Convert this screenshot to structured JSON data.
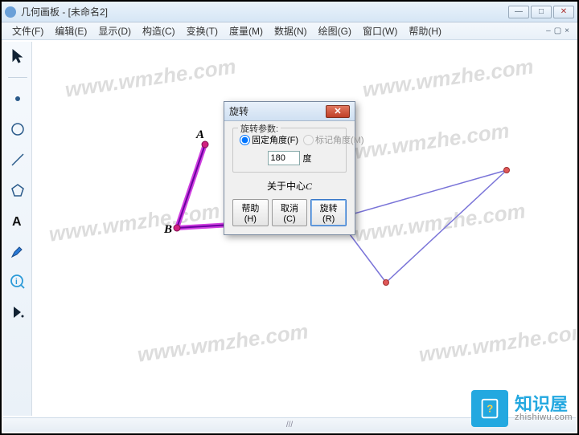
{
  "window": {
    "title": "几何画板 - [未命名2]"
  },
  "menu": {
    "items": [
      "文件(F)",
      "编辑(E)",
      "显示(D)",
      "构造(C)",
      "变换(T)",
      "度量(M)",
      "数据(N)",
      "绘图(G)",
      "窗口(W)",
      "帮助(H)"
    ]
  },
  "labels": {
    "A": "A",
    "B": "B"
  },
  "watermark": "www.wmzhe.com",
  "dialog": {
    "title": "旋转",
    "group_label": "旋转参数:",
    "radio_fixed": "固定角度(F)",
    "radio_marked": "标记角度(M)",
    "angle_value": "180",
    "degree_unit": "度",
    "center_prefix": "关于中心",
    "center_point": "C",
    "btn_help": "帮助(H)",
    "btn_cancel": "取消(C)",
    "btn_rotate": "旋转(R)"
  },
  "brand": {
    "name": "知识屋",
    "domain": "zhishiwu.com"
  },
  "statusbar": {
    "grip": "///"
  }
}
